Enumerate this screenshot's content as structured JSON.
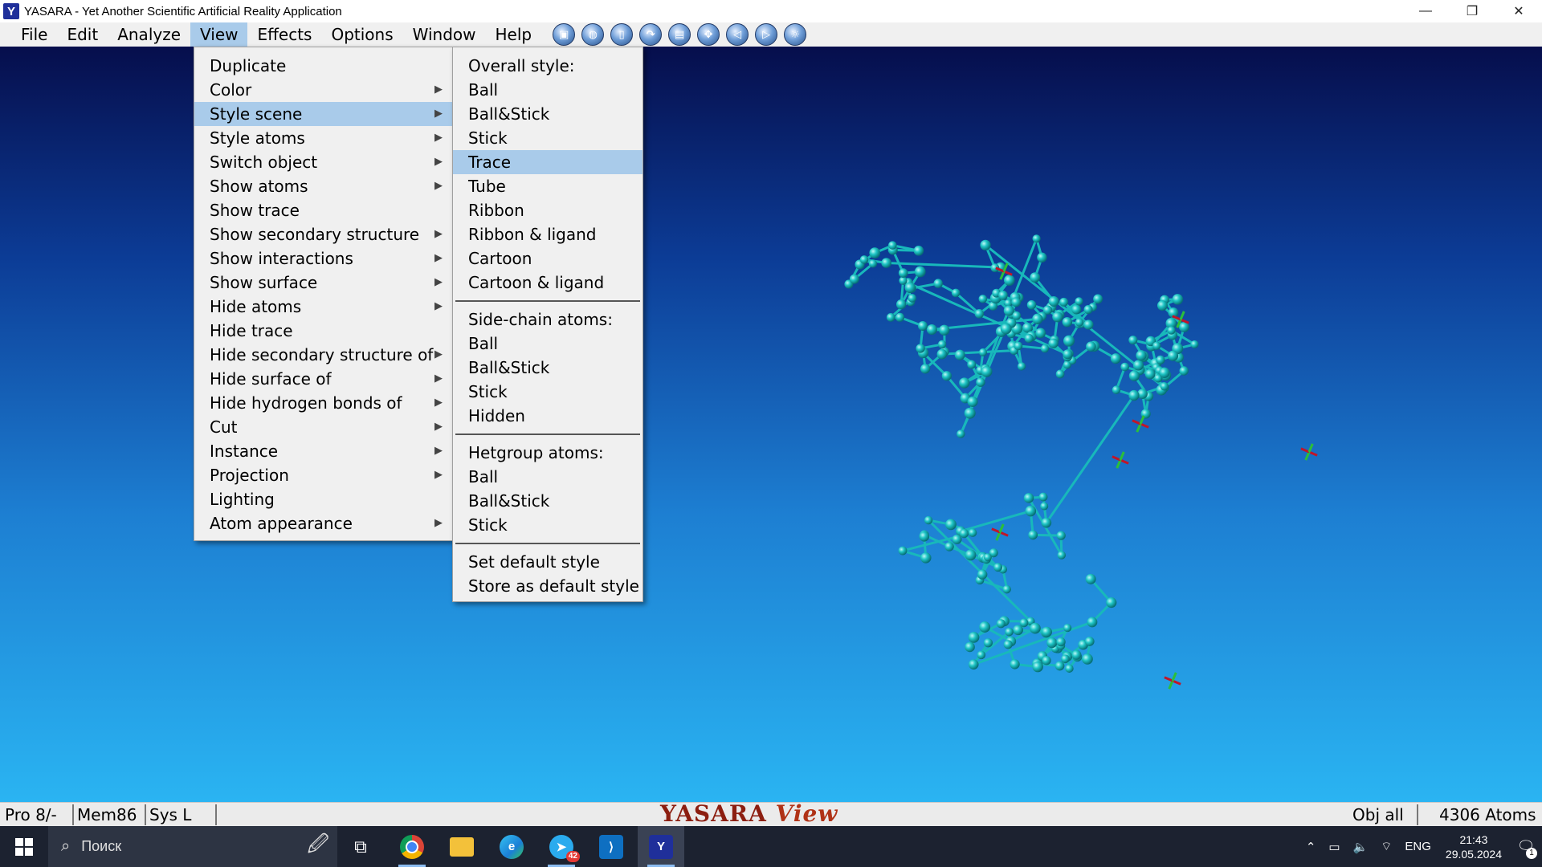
{
  "window": {
    "title": "YASARA - Yet Another Scientific Artificial Reality Application",
    "app_icon_letter": "Y",
    "minimize": "—",
    "restore": "❐",
    "close": "✕"
  },
  "menubar": {
    "items": [
      "File",
      "Edit",
      "Analyze",
      "View",
      "Effects",
      "Options",
      "Window",
      "Help"
    ],
    "active": "View",
    "toolbar_icons": [
      "screen-icon",
      "globe-icon",
      "page-icon",
      "redo-icon",
      "save-icon",
      "move-icon",
      "rewind-icon",
      "forward-icon",
      "sun-icon"
    ]
  },
  "view_menu": {
    "items": [
      {
        "label": "Duplicate",
        "submenu": false
      },
      {
        "label": "Color",
        "submenu": true
      },
      {
        "label": "Style scene",
        "submenu": true,
        "selected": true
      },
      {
        "label": "Style atoms",
        "submenu": true
      },
      {
        "label": "Switch object",
        "submenu": true
      },
      {
        "label": "Show atoms",
        "submenu": true
      },
      {
        "label": "Show trace",
        "submenu": false
      },
      {
        "label": "Show secondary structure",
        "submenu": true
      },
      {
        "label": "Show interactions",
        "submenu": true
      },
      {
        "label": "Show surface",
        "submenu": true
      },
      {
        "label": "Hide atoms",
        "submenu": true
      },
      {
        "label": "Hide trace",
        "submenu": false
      },
      {
        "label": "Hide secondary structure of",
        "submenu": true
      },
      {
        "label": "Hide surface of",
        "submenu": true
      },
      {
        "label": "Hide hydrogen bonds of",
        "submenu": true
      },
      {
        "label": "Cut",
        "submenu": true
      },
      {
        "label": "Instance",
        "submenu": true
      },
      {
        "label": "Projection",
        "submenu": true
      },
      {
        "label": "Lighting",
        "submenu": false
      },
      {
        "label": "Atom appearance",
        "submenu": true
      }
    ]
  },
  "style_menu": {
    "overall_header": "Overall style:",
    "overall": [
      "Ball",
      "Ball&Stick",
      "Stick",
      "Trace",
      "Tube",
      "Ribbon",
      "Ribbon & ligand",
      "Cartoon",
      "Cartoon & ligand"
    ],
    "overall_selected": "Trace",
    "sidechain_header": "Side-chain atoms:",
    "sidechain": [
      "Ball",
      "Ball&Stick",
      "Stick",
      "Hidden"
    ],
    "hetgroup_header": "Hetgroup atoms:",
    "hetgroup": [
      "Ball",
      "Ball&Stick",
      "Stick"
    ],
    "actions": [
      "Set default style",
      "Store as default style"
    ]
  },
  "statusbar": {
    "pro": "Pro 8/-",
    "mem": "Mem86",
    "sys": "Sys L",
    "logo_main": "YASARA",
    "logo_edition": "View",
    "obj": "Obj all",
    "atoms": "4306 Atoms"
  },
  "taskbar": {
    "search_placeholder": "Поиск",
    "telegram_badge": "42",
    "lang": "ENG",
    "time": "21:43",
    "date": "29.05.2024",
    "notifications": "1"
  },
  "colors": {
    "menu_highlight": "#a9cbea",
    "molecule": "#1fc6c6",
    "ligand": "#c0162a"
  }
}
